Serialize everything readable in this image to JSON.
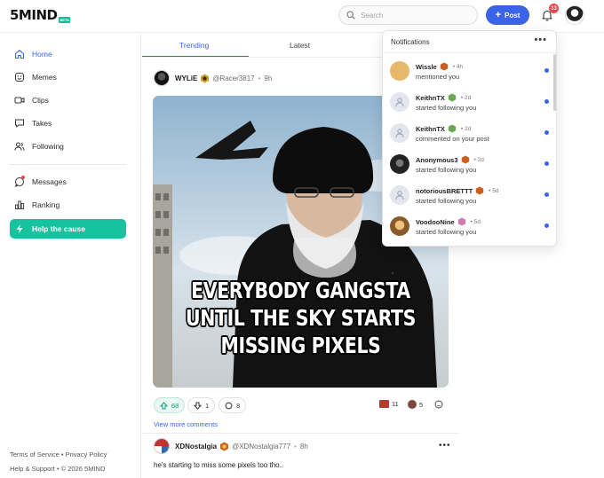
{
  "header": {
    "logo": "5MIND",
    "logo_tag": "BETA",
    "search_placeholder": "Search",
    "post_label": "Post",
    "notification_count": "13"
  },
  "sidebar": {
    "items": [
      {
        "label": "Home"
      },
      {
        "label": "Memes"
      },
      {
        "label": "Clips"
      },
      {
        "label": "Takes"
      },
      {
        "label": "Following"
      },
      {
        "label": "Messages"
      },
      {
        "label": "Ranking"
      },
      {
        "label": "Help the cause"
      }
    ],
    "footer_line1": "Terms of Service • Privacy Policy",
    "footer_line2": "Help & Support • © 2026 5MIND"
  },
  "feed": {
    "tabs": [
      "Trending",
      "Latest"
    ],
    "post1": {
      "username": "WYLiE",
      "handle": "@Racer3817",
      "time": "9h",
      "meme_text": [
        "EVERYBODY GANGSTA",
        "UNTIL THE SKY STARTS",
        "MISSING PIXELS"
      ],
      "upvotes": "68",
      "downvotes": "1",
      "comments": "8",
      "reaction1_count": "11",
      "reaction2_count": "5",
      "more_comments": "View more comments"
    },
    "post2": {
      "username": "XDNostalgia",
      "handle": "@XDNostalgia777",
      "time": "8h",
      "text": "he's starting to miss some pixels too tho.."
    }
  },
  "notifications": {
    "title": "Notifications",
    "items": [
      {
        "name": "Wissle",
        "time": "4h",
        "action": "mentioned you"
      },
      {
        "name": "KeithnTX",
        "time": "2d",
        "action": "started following you"
      },
      {
        "name": "KeithnTX",
        "time": "2d",
        "action": "commented on your post"
      },
      {
        "name": "Anonymous3",
        "time": "2d",
        "action": "started following you"
      },
      {
        "name": "notoriousBRETTT",
        "time": "5d",
        "action": "started following you"
      },
      {
        "name": "VoodooNine",
        "time": "5d",
        "action": "started following you"
      }
    ]
  },
  "colors": {
    "accent": "#3a63e8",
    "brand": "#17c29f",
    "badge_red": "#e5484d"
  }
}
